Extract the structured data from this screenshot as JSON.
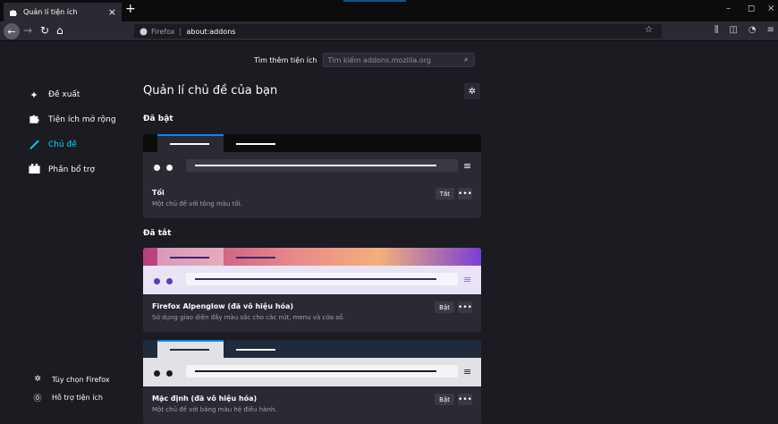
{
  "browser": {
    "tab_title": "Quản lí tiện ích",
    "new_tab": "+",
    "tab_close": "×",
    "url_brand": "Firefox",
    "url": "about:addons",
    "win_min": "–",
    "win_max": "◻",
    "win_close": "×"
  },
  "search": {
    "label": "Tìm thêm tiện ích",
    "placeholder": "Tìm kiếm addons.mozilla.org"
  },
  "sidebar": {
    "items": [
      {
        "label": "Đề xuất",
        "icon": "recommendations-icon",
        "active": false
      },
      {
        "label": "Tiện ích mở rộng",
        "icon": "extensions-icon",
        "active": false
      },
      {
        "label": "Chủ đề",
        "icon": "themes-icon",
        "active": true
      },
      {
        "label": "Phần bổ trợ",
        "icon": "plugins-icon",
        "active": false
      }
    ],
    "bottom": [
      {
        "label": "Tùy chọn Firefox",
        "icon": "gear-icon"
      },
      {
        "label": "Hỗ trợ tiện ích",
        "icon": "help-icon"
      }
    ]
  },
  "main": {
    "heading": "Quản lí chủ đề của bạn",
    "enabled_heading": "Đã bật",
    "disabled_heading": "Đã tắt",
    "themes": [
      {
        "name": "Tối",
        "desc": "Một chủ đề với tông màu tối.",
        "button": "Tắt",
        "more": "•••"
      },
      {
        "name": "Firefox Alpenglow (đã vô hiệu hóa)",
        "desc": "Sử dụng giao diện đầy màu sắc cho các nút, menu và cửa sổ.",
        "button": "Bật",
        "more": "•••"
      },
      {
        "name": "Mặc định (đã vô hiệu hóa)",
        "desc": "Một chủ đề với bảng màu hệ điều hành.",
        "button": "Bật",
        "more": "•••"
      }
    ]
  },
  "colors": {
    "accent": "#00ddff",
    "background": "#1c1b22",
    "card": "#2b2a33"
  }
}
